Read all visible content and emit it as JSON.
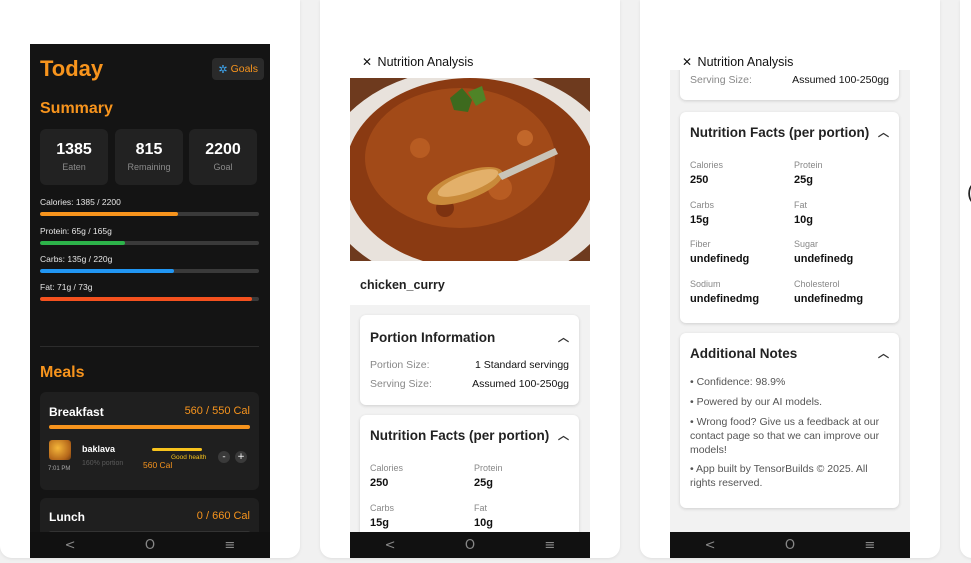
{
  "screen1": {
    "title": "Today",
    "goals_label": "Goals",
    "summary_title": "Summary",
    "stats": [
      {
        "value": "1385",
        "label": "Eaten"
      },
      {
        "value": "815",
        "label": "Remaining"
      },
      {
        "value": "2200",
        "label": "Goal"
      }
    ],
    "macros": [
      {
        "label": "Calories: 1385 / 2200",
        "progress": 0.63,
        "color": "#f7941d"
      },
      {
        "label": "Protein: 65g / 165g",
        "progress": 0.39,
        "color": "#2db34a"
      },
      {
        "label": "Carbs: 135g / 220g",
        "progress": 0.61,
        "color": "#2196f3"
      },
      {
        "label": "Fat: 71g / 73g",
        "progress": 0.97,
        "color": "#f4511e"
      }
    ],
    "meals_title": "Meals",
    "breakfast": {
      "name": "Breakfast",
      "cal": "560 / 550 Cal",
      "item": {
        "time": "7:01 PM",
        "name": "baklava",
        "portion": "160% portion",
        "cal": "560 Cal",
        "health": "Good health",
        "minus": "-",
        "plus": "+"
      }
    },
    "lunch": {
      "name": "Lunch",
      "cal": "0 / 660 Cal"
    }
  },
  "nav": {
    "back": "<",
    "home": "O",
    "menu": "≡"
  },
  "screen2": {
    "close": "✕",
    "title": "Nutrition Analysis",
    "food_name": "chicken_curry",
    "portion_panel": {
      "title": "Portion Information",
      "rows": [
        {
          "k": "Portion Size:",
          "v": "1 Standard servingg"
        },
        {
          "k": "Serving Size:",
          "v": "Assumed 100-250gg"
        }
      ]
    },
    "facts_title": "Nutrition Facts (per portion)",
    "facts": [
      {
        "k": "Calories",
        "v": "250"
      },
      {
        "k": "Protein",
        "v": "25g"
      },
      {
        "k": "Carbs",
        "v": "15g"
      },
      {
        "k": "Fat",
        "v": "10g"
      }
    ]
  },
  "screen3": {
    "close": "✕",
    "title": "Nutrition Analysis",
    "serving_k": "Serving Size:",
    "serving_v": "Assumed 100-250gg",
    "facts_title": "Nutrition Facts (per portion)",
    "facts": [
      {
        "k": "Calories",
        "v": "250"
      },
      {
        "k": "Protein",
        "v": "25g"
      },
      {
        "k": "Carbs",
        "v": "15g"
      },
      {
        "k": "Fat",
        "v": "10g"
      },
      {
        "k": "Fiber",
        "v": "undefinedg"
      },
      {
        "k": "Sugar",
        "v": "undefinedg"
      },
      {
        "k": "Sodium",
        "v": "undefinedmg"
      },
      {
        "k": "Cholesterol",
        "v": "undefinedmg"
      }
    ],
    "notes_title": "Additional Notes",
    "notes": [
      "• Confidence: 98.9%",
      "• Powered by our AI models.",
      "• Wrong food? Give us a feedback at our contact page so that we can improve our models!",
      "• App built by TensorBuilds © 2025. All rights reserved."
    ]
  },
  "edge_glyph": "("
}
